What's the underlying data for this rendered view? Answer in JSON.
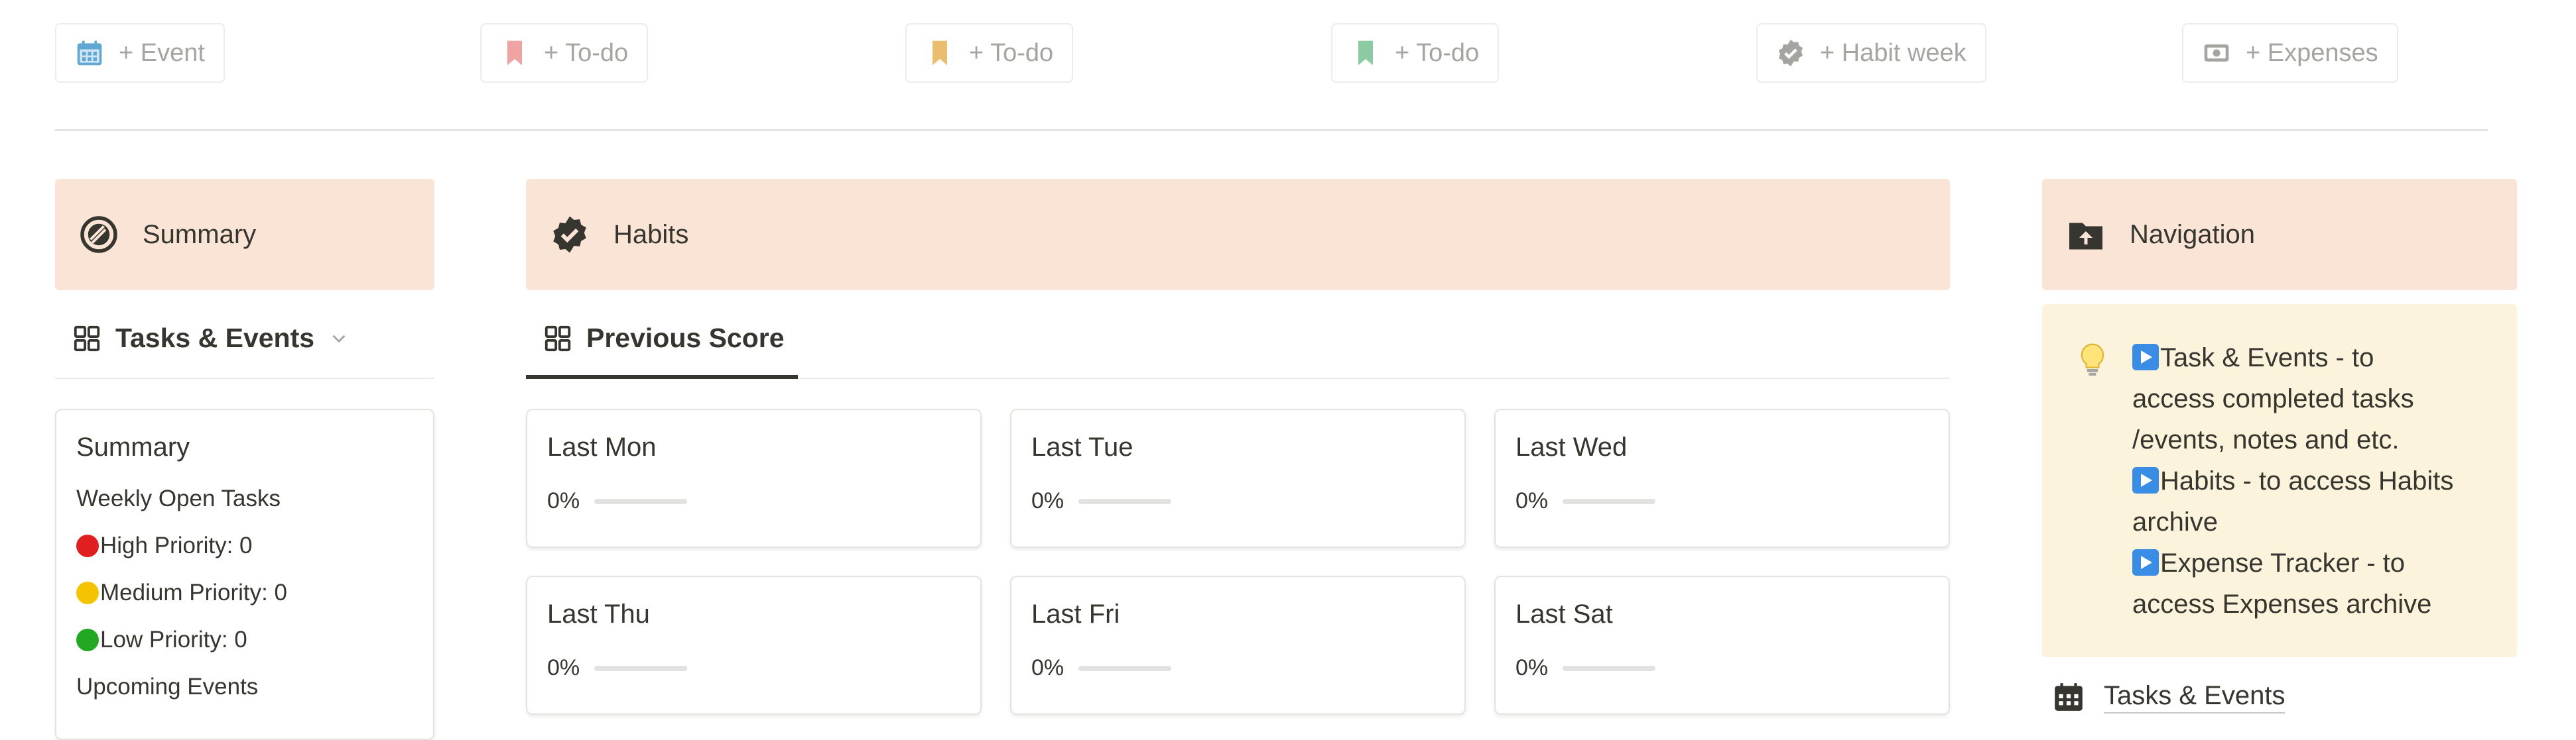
{
  "quick_add": [
    {
      "label": "+ Event",
      "icon": "calendar-icon",
      "color": "#5fa8d3"
    },
    {
      "label": "+ To-do",
      "icon": "bookmark-icon",
      "color": "#f0a3a3"
    },
    {
      "label": "+ To-do",
      "icon": "bookmark-icon",
      "color": "#ebbd6e"
    },
    {
      "label": "+ To-do",
      "icon": "bookmark-icon",
      "color": "#8ccaa3"
    },
    {
      "label": "+ Habit week",
      "icon": "verified-badge-icon",
      "color": "#a5a4a0"
    },
    {
      "label": "+ Expenses",
      "icon": "money-icon",
      "color": "#a5a4a0"
    }
  ],
  "summary_section": {
    "header": "Summary",
    "tab_label": "Tasks & Events",
    "card": {
      "title": "Summary",
      "weekly_open_tasks": "Weekly Open Tasks",
      "high": "High Priority: 0",
      "medium": "Medium Priority: 0",
      "low": "Low Priority: 0",
      "upcoming": "Upcoming Events"
    }
  },
  "habits_section": {
    "header": "Habits",
    "tab_label": "Previous Score",
    "cards": [
      {
        "title": "Last Mon",
        "percent": "0%",
        "progress": 0
      },
      {
        "title": "Last Tue",
        "percent": "0%",
        "progress": 0
      },
      {
        "title": "Last Wed",
        "percent": "0%",
        "progress": 0
      },
      {
        "title": "Last Thu",
        "percent": "0%",
        "progress": 0
      },
      {
        "title": "Last Fri",
        "percent": "0%",
        "progress": 0
      },
      {
        "title": "Last Sat",
        "percent": "0%",
        "progress": 0
      }
    ]
  },
  "navigation_section": {
    "header": "Navigation",
    "callout_lines": [
      "Task & Events - to",
      "access completed tasks",
      "/events, notes and etc.",
      "Habits - to access Habits",
      "archive",
      "Expense Tracker - to",
      "access Expenses archive"
    ],
    "link_label": "Tasks & Events"
  },
  "colors": {
    "callout_header_bg": "#f9e4d5",
    "nav_callout_bg": "#fbf3db",
    "priority_high": "#e02020",
    "priority_medium": "#f5c400",
    "priority_low": "#22a822"
  }
}
